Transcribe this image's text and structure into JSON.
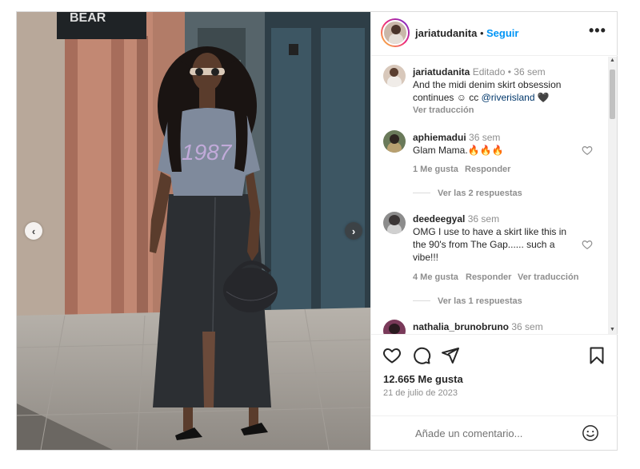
{
  "header": {
    "username": "jariatudanita",
    "separator": "•",
    "follow_label": "Seguir",
    "more_label": "•••"
  },
  "caption": {
    "username": "jariatudanita",
    "meta": "Editado • 36 sem",
    "line1": "And the midi denim skirt obsession",
    "line2_prefix": "continues ☺ cc ",
    "mention": "@riverisland",
    "line2_suffix": " 🖤",
    "translate": "Ver traducción"
  },
  "comments": [
    {
      "username": "aphiemadui",
      "time": "36 sem",
      "text_lines": [
        "Glam Mama.🔥🔥🔥"
      ],
      "likes": "1 Me gusta",
      "reply": "Responder",
      "translate": "",
      "replies": "Ver las 2 respuestas"
    },
    {
      "username": "deedeegyal",
      "time": "36 sem",
      "text_lines": [
        "OMG I use to have a skirt like this in",
        "the 90's from The Gap...... such a",
        "vibe!!!"
      ],
      "likes": "4 Me gusta",
      "reply": "Responder",
      "translate": "Ver traducción",
      "replies": "Ver las 1 respuestas"
    },
    {
      "username": "nathalia_brunobruno",
      "time": "36 sem"
    }
  ],
  "scrollbar": {
    "up": "▲",
    "down": "▼"
  },
  "actions": {
    "icons": [
      "heart-icon",
      "comment-icon",
      "share-icon",
      "bookmark-icon"
    ],
    "likes": "12.665 Me gusta",
    "date": "21 de julio de 2023"
  },
  "composer": {
    "placeholder": "Añade un comentario...",
    "emoji_icon": "smiley-icon"
  },
  "photo": {
    "sign_text": "BEAR",
    "shirt_text": "1987",
    "prev_icon": "‹",
    "next_icon": "›"
  },
  "colors": {
    "accent": "#0095f6",
    "text": "#262626",
    "muted": "#8e8e8e",
    "link": "#00376b"
  }
}
